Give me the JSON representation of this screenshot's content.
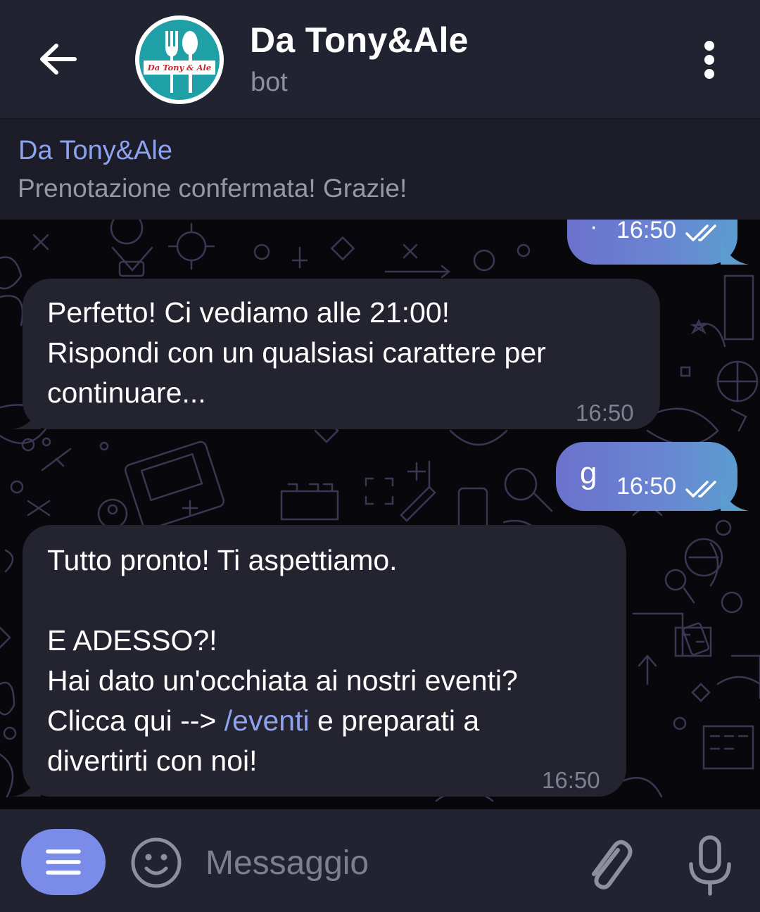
{
  "header": {
    "title": "Da Tony&Ale",
    "subtitle": "bot",
    "avatar_logo_text": "Da Tony & Ale",
    "back_icon": "arrow-left-icon",
    "more_icon": "more-vertical-icon"
  },
  "pinned": {
    "title": "Da Tony&Ale",
    "text": "Prenotazione confermata! Grazie!"
  },
  "messages": [
    {
      "direction": "out",
      "text": "·",
      "time": "16:50",
      "status": "read"
    },
    {
      "direction": "in",
      "lines": [
        "Perfetto! Ci vediamo alle 21:00!",
        "Rispondi con un qualsiasi carattere per",
        "continuare..."
      ],
      "time": "16:50"
    },
    {
      "direction": "out",
      "text": "g",
      "time": "16:50",
      "status": "read"
    },
    {
      "direction": "in",
      "line1": "Tutto pronto! Ti aspettiamo.",
      "line2": "E ADESSO?!",
      "line3": "Hai dato un'occhiata ai nostri eventi?",
      "line4_prefix": "Clicca qui --> ",
      "line4_link": "/eventi",
      "line4_suffix": " e preparati a",
      "line5": "divertirti con noi!",
      "time": "16:50"
    }
  ],
  "input": {
    "placeholder": "Messaggio",
    "menu_icon": "menu-icon",
    "emoji_icon": "emoji-icon",
    "attach_icon": "paperclip-icon",
    "mic_icon": "microphone-icon"
  },
  "colors": {
    "header_bg": "#222330",
    "pinned_title": "#8ea3f0",
    "incoming_bubble": "#232430",
    "outgoing_gradient_start": "#6b72cc",
    "outgoing_gradient_end": "#5c9ccf",
    "link": "#8ea3f0",
    "menu_button": "#7b8be8"
  }
}
